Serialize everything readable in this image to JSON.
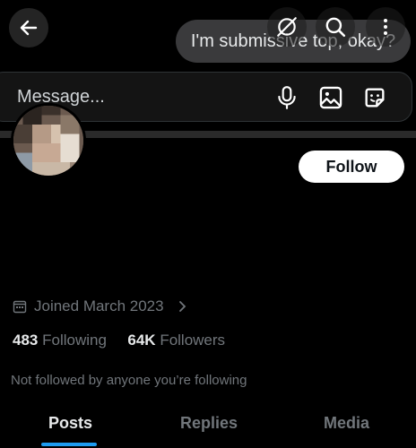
{
  "chat": {
    "bubble_text": "I'm submissive top, okay?"
  },
  "composer": {
    "placeholder": "Message..."
  },
  "profile": {
    "follow_label": "Follow",
    "joined": "Joined March 2023",
    "following_count": "483",
    "following_label": "Following",
    "followers_count": "64K",
    "followers_label": "Followers",
    "not_followed_text": "Not followed by anyone you’re following"
  },
  "tabs": [
    {
      "label": "Posts",
      "active": true
    },
    {
      "label": "Replies",
      "active": false
    },
    {
      "label": "Media",
      "active": false
    }
  ],
  "icons": {
    "back": "arrow-left-icon",
    "no_grok": "slash-circle-icon",
    "search": "search-icon",
    "more": "more-vertical-icon",
    "mic": "microphone-icon",
    "image": "image-icon",
    "sticker": "sticker-icon",
    "calendar": "calendar-icon",
    "chevron": "chevron-right-icon"
  },
  "colors": {
    "accent": "#1d9bf0",
    "background": "#000000",
    "muted": "#71767b"
  }
}
